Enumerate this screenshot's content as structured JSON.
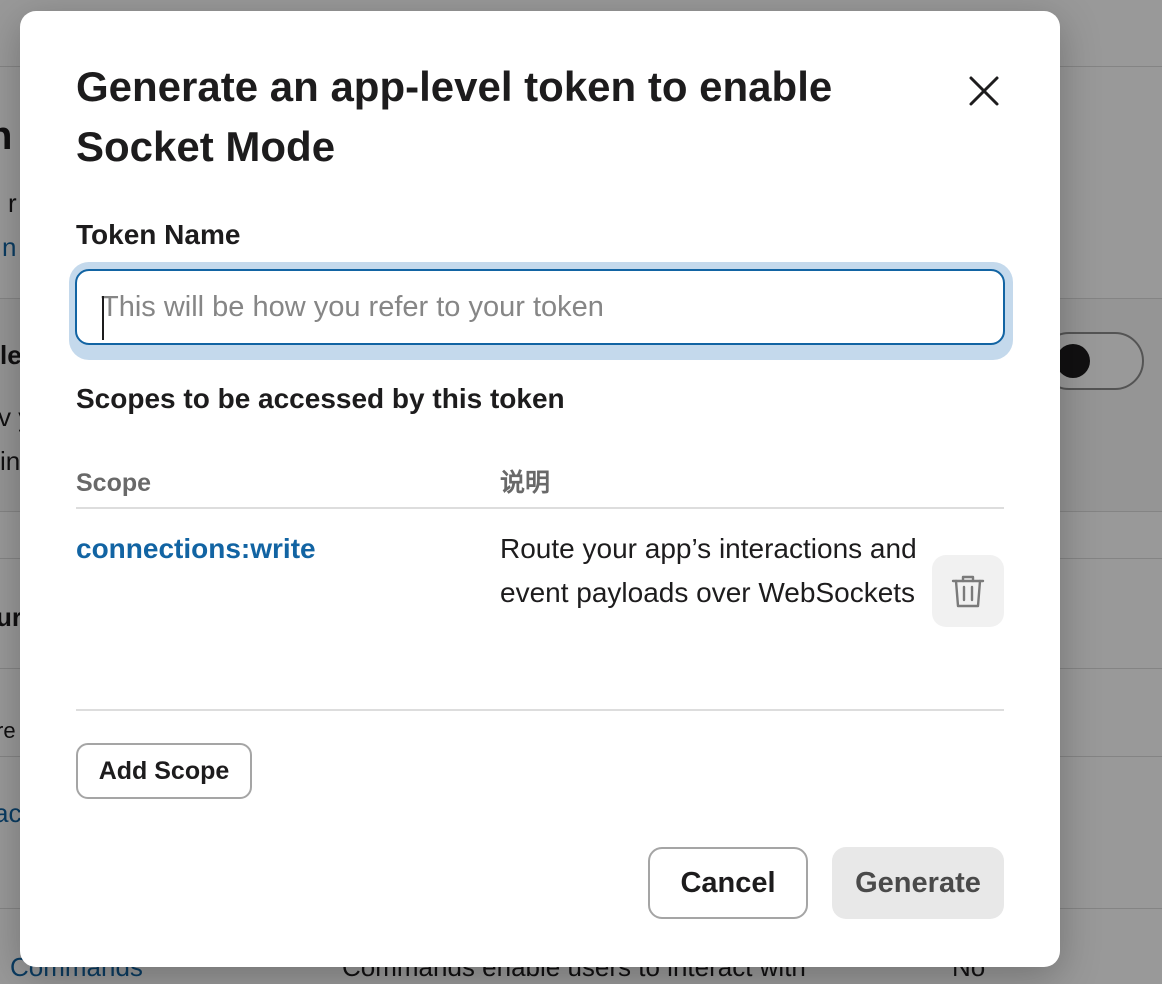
{
  "background": {
    "heading_fragment": "n",
    "text_fragment_1": "r",
    "link_fragment_1": "n",
    "panel_heading_fragment": "le",
    "panel_text_fragment_1": "v y",
    "panel_text_fragment_2": "in",
    "row_heading_fragment": "ur",
    "row_text_fragment": "re",
    "row_link_fragment": "ac",
    "bottom_link": "Commands",
    "bottom_description": "Commands enable users to interact with",
    "bottom_status": "No"
  },
  "modal": {
    "title": "Generate an app-level token to enable Socket Mode",
    "token_name_label": "Token Name",
    "token_name_value": "",
    "token_name_placeholder": "This will be how you refer to your token",
    "scopes_heading": "Scopes to be accessed by this token",
    "columns": {
      "scope": "Scope",
      "description": "说明"
    },
    "scopes": [
      {
        "name": "connections:write",
        "description": "Route your app’s interactions and event payloads over WebSockets"
      }
    ],
    "add_scope_label": "Add Scope",
    "cancel_label": "Cancel",
    "generate_label": "Generate"
  },
  "colors": {
    "link": "#1264a3",
    "focus_border": "#1264a3",
    "focus_ring": "#c4d9ec",
    "disabled_button_bg": "#e8e8e8",
    "overlay": "rgba(0,0,0,0.40)"
  },
  "icons": {
    "close": "close-icon",
    "delete": "trash-icon"
  }
}
